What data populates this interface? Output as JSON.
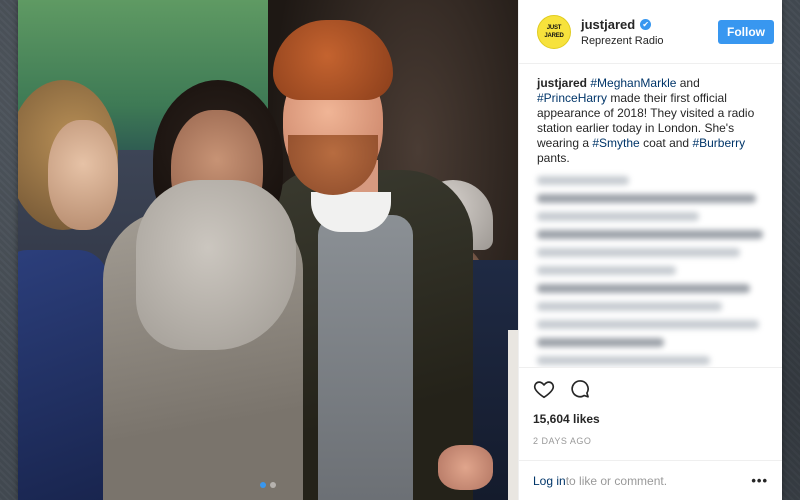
{
  "header": {
    "avatar_text_1": "JUST",
    "avatar_text_2": "JARED",
    "username": "justjared",
    "verified_mark": "✔",
    "location": "Reprezent Radio",
    "follow_label": "Follow"
  },
  "caption": {
    "username": "justjared",
    "parts": [
      {
        "text": "#MeghanMarkle",
        "type": "tag"
      },
      {
        "text": " and ",
        "type": "text"
      },
      {
        "text": "#PrinceHarry",
        "type": "tag"
      },
      {
        "text": " made their first official appearance of 2018! They visited a radio station earlier today in London. She's wearing a ",
        "type": "text"
      },
      {
        "text": "#Smythe",
        "type": "tag"
      },
      {
        "text": " coat and ",
        "type": "text"
      },
      {
        "text": "#Burberry",
        "type": "tag"
      },
      {
        "text": " pants.",
        "type": "text"
      }
    ]
  },
  "actions": {
    "like_icon": "heart-icon",
    "comment_icon": "comment-icon"
  },
  "likes": "15,604 likes",
  "timestamp": "2 DAYS AGO",
  "footer": {
    "login_link": "Log in",
    "login_suffix": " to like or comment.",
    "more_label": "•••"
  },
  "carousel": {
    "count": 2,
    "active": 0
  },
  "colors": {
    "accent": "#3897f0",
    "link": "#003569",
    "avatar_bg": "#f7e23c"
  }
}
